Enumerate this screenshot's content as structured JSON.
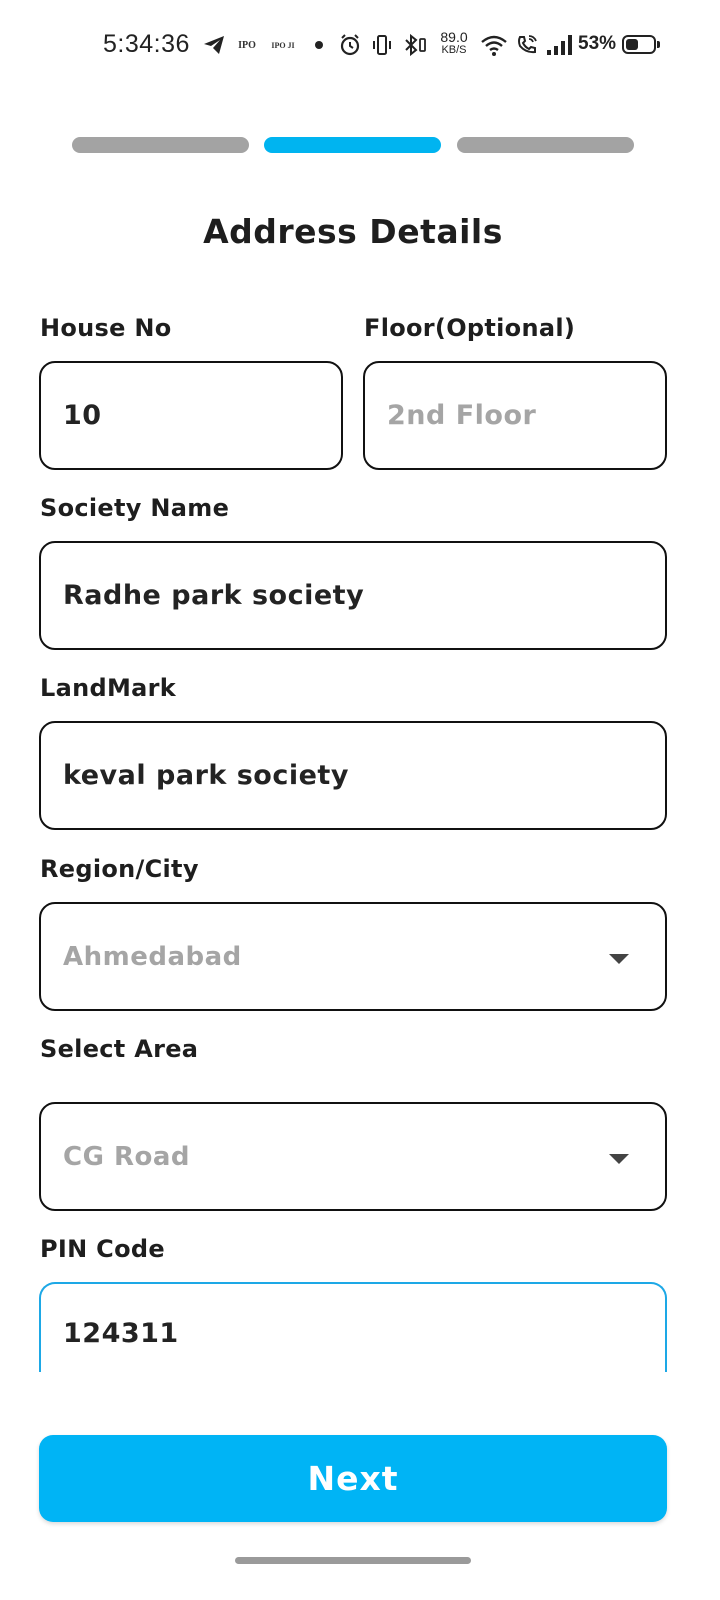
{
  "status_bar": {
    "time": "5:34:36",
    "ipo_small": "IPO",
    "ipo_text": "IPO JI",
    "net_speed_value": "89.0",
    "net_speed_unit": "KB/S",
    "battery_percent": "53%",
    "battery_level": 0.53,
    "icons": [
      "telegram-icon",
      "ipo-icon",
      "ipo-ji-icon",
      "dot-icon",
      "alarm-icon",
      "vibrate-icon",
      "bluetooth-icon",
      "wifi-icon",
      "wifi-call-icon",
      "signal-icon",
      "battery-icon"
    ]
  },
  "progress": {
    "steps": 3,
    "current_step": 2,
    "active_color": "#00b4f0",
    "inactive_color": "#a3a3a3"
  },
  "page": {
    "title": "Address Details"
  },
  "form": {
    "house_no": {
      "label": "House No",
      "value": "10",
      "placeholder": ""
    },
    "floor": {
      "label": "Floor(Optional)",
      "value": "",
      "placeholder": "2nd Floor"
    },
    "society_name": {
      "label": "Society Name",
      "value": "Radhe park society"
    },
    "landmark": {
      "label": "LandMark",
      "value": "keval park society"
    },
    "region_city": {
      "label": "Region/City",
      "value": "Ahmedabad",
      "icon": "dropdown-caret-icon"
    },
    "select_area": {
      "label": "Select Area",
      "value": "CG Road",
      "icon": "dropdown-caret-icon"
    },
    "pin_code": {
      "label": "PIN Code",
      "value": "124311",
      "focus_color": "#1da8e6"
    }
  },
  "actions": {
    "next_label": "Next",
    "accent": "#00b4f5"
  }
}
